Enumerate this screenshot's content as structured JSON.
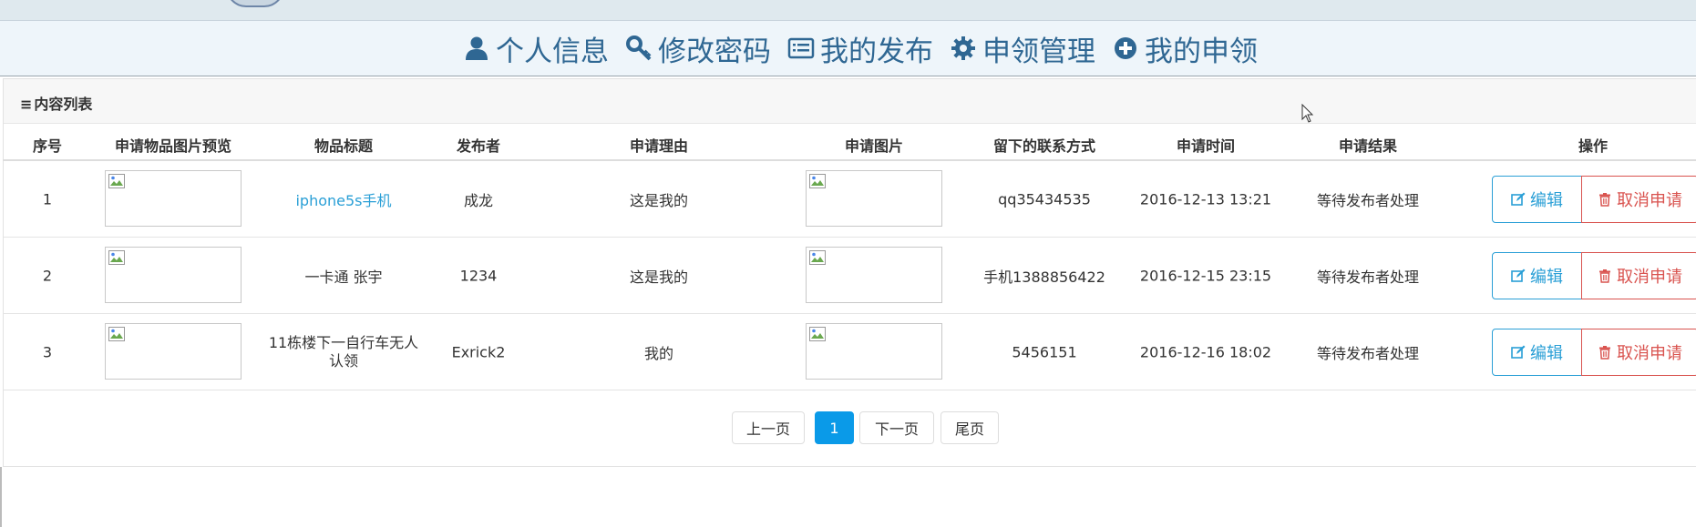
{
  "nav": {
    "items": [
      {
        "label": "个人信息",
        "icon": "user-icon"
      },
      {
        "label": "修改密码",
        "icon": "key-icon"
      },
      {
        "label": "我的发布",
        "icon": "list-icon"
      },
      {
        "label": "申领管理",
        "icon": "gear-icon"
      },
      {
        "label": "我的申领",
        "icon": "plus-circle-icon"
      }
    ],
    "color": "#2f6793"
  },
  "panel": {
    "title_icon": "≡",
    "title": "内容列表"
  },
  "table": {
    "headers": [
      "序号",
      "申请物品图片预览",
      "物品标题",
      "发布者",
      "申请理由",
      "申请图片",
      "留下的联系方式",
      "申请时间",
      "申请结果",
      "操作"
    ],
    "rows": [
      {
        "index": "1",
        "title": "iphone5s手机",
        "publisher": "成龙",
        "reason": "这是我的",
        "contact": "qq35434535",
        "time": "2016-12-13 13:21",
        "result": "等待发布者处理"
      },
      {
        "index": "2",
        "title": "一卡通 张宇",
        "publisher": "1234",
        "reason": "这是我的",
        "contact": "手机1388856422",
        "time": "2016-12-15 23:15",
        "result": "等待发布者处理"
      },
      {
        "index": "3",
        "title": "11栋楼下一自行车无人认领",
        "publisher": "Exrick2",
        "reason": "我的",
        "contact": "5456151",
        "time": "2016-12-16 18:02",
        "result": "等待发布者处理"
      }
    ],
    "edit_label": "编辑",
    "cancel_label": "取消申请"
  },
  "pagination": {
    "prev": "上一页",
    "current": "1",
    "next": "下一页",
    "last": "尾页"
  },
  "colors": {
    "link": "#2a9fd6",
    "danger": "#d9534f",
    "active_page": "#0a9ae8"
  }
}
